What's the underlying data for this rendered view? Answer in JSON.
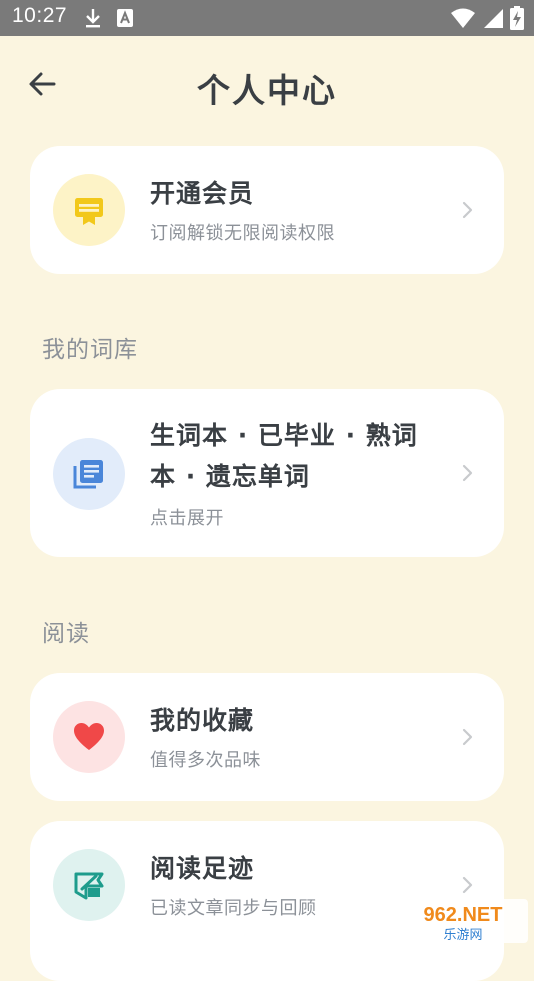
{
  "status_bar": {
    "time": "10:27",
    "icons": [
      "download-icon",
      "notification-a-icon",
      "wifi-icon",
      "signal-icon",
      "battery-charging-icon"
    ]
  },
  "header": {
    "title": "个人中心",
    "back_icon": "arrow-left-icon"
  },
  "cards": {
    "vip": {
      "title": "开通会员",
      "subtitle": "订阅解锁无限阅读权限",
      "icon": "vip-badge-icon",
      "icon_bg": "#fdf3c7",
      "icon_color": "#f2c81a"
    },
    "wordbook": {
      "title_line1": "生词本 · 已毕业 · 熟词",
      "title_line2": "本 · 遗忘单词",
      "subtitle": "点击展开",
      "icon": "book-list-icon",
      "icon_bg": "#e2ecfa",
      "icon_color": "#4a86d9"
    },
    "favorites": {
      "title": "我的收藏",
      "subtitle": "值得多次品味",
      "icon": "heart-icon",
      "icon_bg": "#fde3e3",
      "icon_color": "#f04848"
    },
    "history": {
      "title": "阅读足迹",
      "subtitle": "已读文章同步与回顾",
      "icon": "footprint-ticket-icon",
      "icon_bg": "#dff2ef",
      "icon_color": "#1e9c8c"
    }
  },
  "sections": {
    "wordbank": "我的词库",
    "reading": "阅读"
  },
  "watermark": {
    "text_top": "962.NET",
    "text_bottom": "乐游网"
  },
  "colors": {
    "background": "#fbf5e0",
    "status_bar": "#7a7a7a",
    "card": "#ffffff",
    "title_text": "#3a3f44",
    "secondary_text": "#8c9198"
  }
}
